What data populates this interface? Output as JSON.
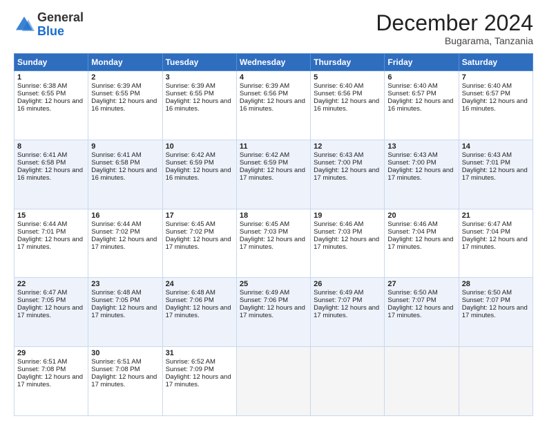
{
  "header": {
    "logo_general": "General",
    "logo_blue": "Blue",
    "month_title": "December 2024",
    "location": "Bugarama, Tanzania"
  },
  "days_of_week": [
    "Sunday",
    "Monday",
    "Tuesday",
    "Wednesday",
    "Thursday",
    "Friday",
    "Saturday"
  ],
  "weeks": [
    [
      {
        "day": "1",
        "sunrise": "6:38 AM",
        "sunset": "6:55 PM",
        "daylight": "12 hours and 16 minutes"
      },
      {
        "day": "2",
        "sunrise": "6:39 AM",
        "sunset": "6:55 PM",
        "daylight": "12 hours and 16 minutes"
      },
      {
        "day": "3",
        "sunrise": "6:39 AM",
        "sunset": "6:55 PM",
        "daylight": "12 hours and 16 minutes"
      },
      {
        "day": "4",
        "sunrise": "6:39 AM",
        "sunset": "6:56 PM",
        "daylight": "12 hours and 16 minutes"
      },
      {
        "day": "5",
        "sunrise": "6:40 AM",
        "sunset": "6:56 PM",
        "daylight": "12 hours and 16 minutes"
      },
      {
        "day": "6",
        "sunrise": "6:40 AM",
        "sunset": "6:57 PM",
        "daylight": "12 hours and 16 minutes"
      },
      {
        "day": "7",
        "sunrise": "6:40 AM",
        "sunset": "6:57 PM",
        "daylight": "12 hours and 16 minutes"
      }
    ],
    [
      {
        "day": "8",
        "sunrise": "6:41 AM",
        "sunset": "6:58 PM",
        "daylight": "12 hours and 16 minutes"
      },
      {
        "day": "9",
        "sunrise": "6:41 AM",
        "sunset": "6:58 PM",
        "daylight": "12 hours and 16 minutes"
      },
      {
        "day": "10",
        "sunrise": "6:42 AM",
        "sunset": "6:59 PM",
        "daylight": "12 hours and 16 minutes"
      },
      {
        "day": "11",
        "sunrise": "6:42 AM",
        "sunset": "6:59 PM",
        "daylight": "12 hours and 17 minutes"
      },
      {
        "day": "12",
        "sunrise": "6:43 AM",
        "sunset": "7:00 PM",
        "daylight": "12 hours and 17 minutes"
      },
      {
        "day": "13",
        "sunrise": "6:43 AM",
        "sunset": "7:00 PM",
        "daylight": "12 hours and 17 minutes"
      },
      {
        "day": "14",
        "sunrise": "6:43 AM",
        "sunset": "7:01 PM",
        "daylight": "12 hours and 17 minutes"
      }
    ],
    [
      {
        "day": "15",
        "sunrise": "6:44 AM",
        "sunset": "7:01 PM",
        "daylight": "12 hours and 17 minutes"
      },
      {
        "day": "16",
        "sunrise": "6:44 AM",
        "sunset": "7:02 PM",
        "daylight": "12 hours and 17 minutes"
      },
      {
        "day": "17",
        "sunrise": "6:45 AM",
        "sunset": "7:02 PM",
        "daylight": "12 hours and 17 minutes"
      },
      {
        "day": "18",
        "sunrise": "6:45 AM",
        "sunset": "7:03 PM",
        "daylight": "12 hours and 17 minutes"
      },
      {
        "day": "19",
        "sunrise": "6:46 AM",
        "sunset": "7:03 PM",
        "daylight": "12 hours and 17 minutes"
      },
      {
        "day": "20",
        "sunrise": "6:46 AM",
        "sunset": "7:04 PM",
        "daylight": "12 hours and 17 minutes"
      },
      {
        "day": "21",
        "sunrise": "6:47 AM",
        "sunset": "7:04 PM",
        "daylight": "12 hours and 17 minutes"
      }
    ],
    [
      {
        "day": "22",
        "sunrise": "6:47 AM",
        "sunset": "7:05 PM",
        "daylight": "12 hours and 17 minutes"
      },
      {
        "day": "23",
        "sunrise": "6:48 AM",
        "sunset": "7:05 PM",
        "daylight": "12 hours and 17 minutes"
      },
      {
        "day": "24",
        "sunrise": "6:48 AM",
        "sunset": "7:06 PM",
        "daylight": "12 hours and 17 minutes"
      },
      {
        "day": "25",
        "sunrise": "6:49 AM",
        "sunset": "7:06 PM",
        "daylight": "12 hours and 17 minutes"
      },
      {
        "day": "26",
        "sunrise": "6:49 AM",
        "sunset": "7:07 PM",
        "daylight": "12 hours and 17 minutes"
      },
      {
        "day": "27",
        "sunrise": "6:50 AM",
        "sunset": "7:07 PM",
        "daylight": "12 hours and 17 minutes"
      },
      {
        "day": "28",
        "sunrise": "6:50 AM",
        "sunset": "7:07 PM",
        "daylight": "12 hours and 17 minutes"
      }
    ],
    [
      {
        "day": "29",
        "sunrise": "6:51 AM",
        "sunset": "7:08 PM",
        "daylight": "12 hours and 17 minutes"
      },
      {
        "day": "30",
        "sunrise": "6:51 AM",
        "sunset": "7:08 PM",
        "daylight": "12 hours and 17 minutes"
      },
      {
        "day": "31",
        "sunrise": "6:52 AM",
        "sunset": "7:09 PM",
        "daylight": "12 hours and 17 minutes"
      },
      null,
      null,
      null,
      null
    ]
  ]
}
